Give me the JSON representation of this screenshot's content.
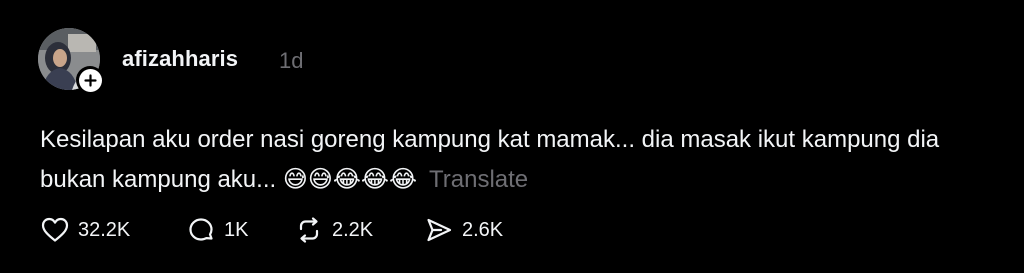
{
  "post": {
    "username": "afizahharis",
    "time": "1d",
    "caption_line1": "Kesilapan aku order nasi goreng kampung kat mamak... dia masak ikut kampung dia",
    "caption_line2": "bukan kampung aku...",
    "emojis": "😅😅😂😂😂",
    "translate_label": "Translate"
  },
  "actions": {
    "likes": "32.2K",
    "comments": "1K",
    "reposts": "2.2K",
    "shares": "2.6K"
  },
  "icons": {
    "like": "heart-icon",
    "comment": "comment-icon",
    "repost": "repost-icon",
    "share": "share-icon",
    "follow": "plus-icon"
  },
  "colors": {
    "background": "#000000",
    "text": "#f3f5f7",
    "muted": "#6e6e73"
  }
}
